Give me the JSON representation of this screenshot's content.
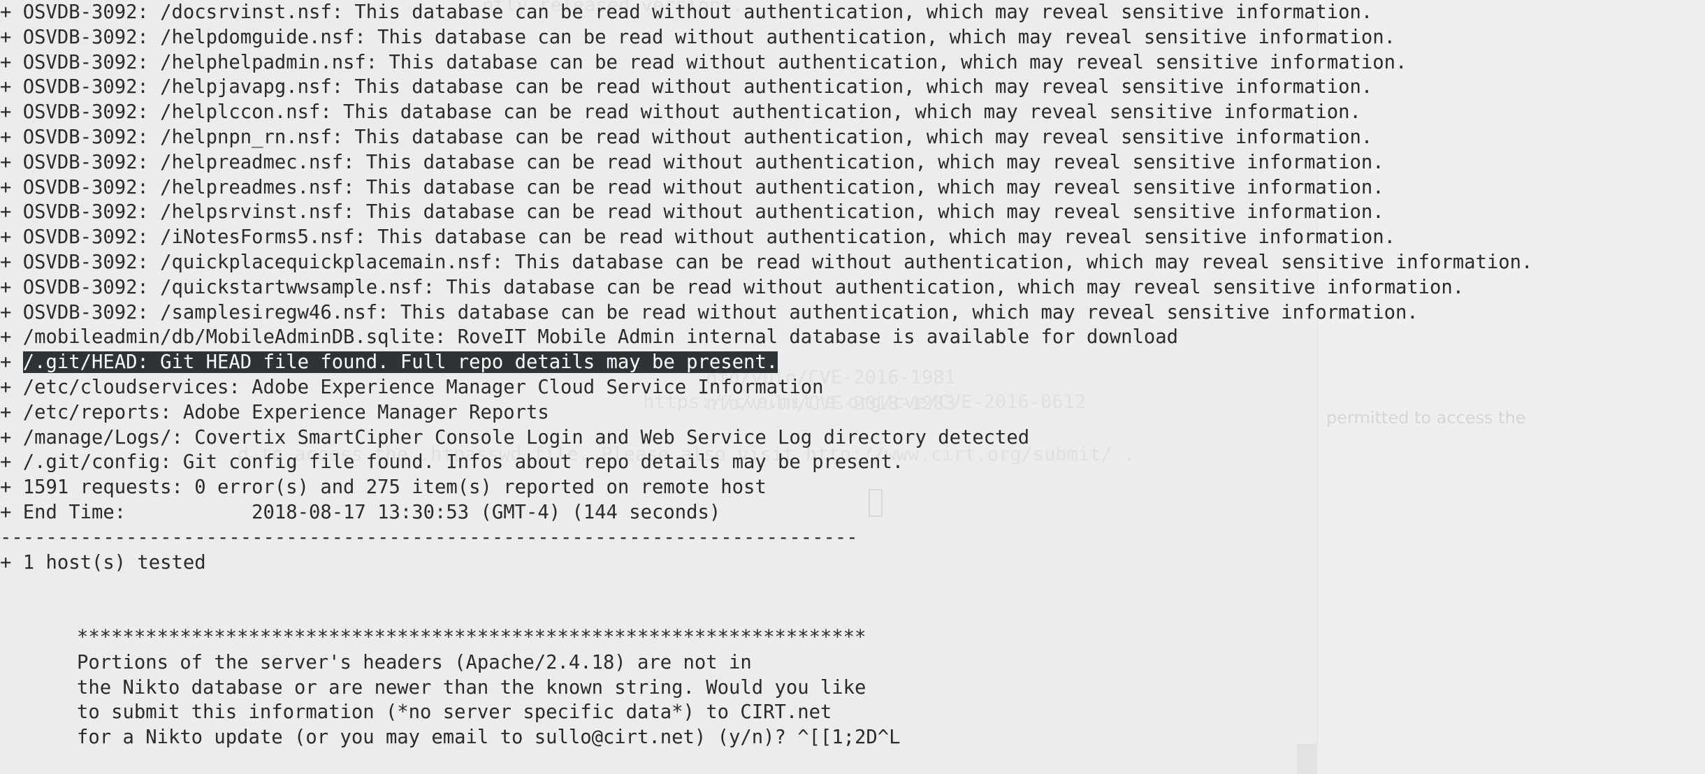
{
  "ghost": {
    "lines": [
      "ntly released versions.",
      "nfo/vuln/CVE-2016-1981",
      "nfo/vuln/CVE-2018-1283",
      "https://cve.mitre.org/cve/CVE-2016-0612",
      "d to access the .htpasswd file. Please also visit http://www.cirt.org/submit/ ."
    ],
    "side_text": "permitted to access the"
  },
  "terminal": {
    "osvdb_lines": [
      {
        "prefix": "+ ",
        "text": "OSVDB-3092: /docsrvinst.nsf: This database can be read without authentication, which may reveal sensitive information."
      },
      {
        "prefix": "+ ",
        "text": "OSVDB-3092: /helpdomguide.nsf: This database can be read without authentication, which may reveal sensitive information."
      },
      {
        "prefix": "+ ",
        "text": "OSVDB-3092: /helphelpadmin.nsf: This database can be read without authentication, which may reveal sensitive information."
      },
      {
        "prefix": "+ ",
        "text": "OSVDB-3092: /helpjavapg.nsf: This database can be read without authentication, which may reveal sensitive information."
      },
      {
        "prefix": "+ ",
        "text": "OSVDB-3092: /helplccon.nsf: This database can be read without authentication, which may reveal sensitive information."
      },
      {
        "prefix": "+ ",
        "text": "OSVDB-3092: /helpnpn_rn.nsf: This database can be read without authentication, which may reveal sensitive information."
      },
      {
        "prefix": "+ ",
        "text": "OSVDB-3092: /helpreadmec.nsf: This database can be read without authentication, which may reveal sensitive information."
      },
      {
        "prefix": "+ ",
        "text": "OSVDB-3092: /helpreadmes.nsf: This database can be read without authentication, which may reveal sensitive information."
      },
      {
        "prefix": "+ ",
        "text": "OSVDB-3092: /helpsrvinst.nsf: This database can be read without authentication, which may reveal sensitive information."
      },
      {
        "prefix": "+ ",
        "text": "OSVDB-3092: /iNotesForms5.nsf: This database can be read without authentication, which may reveal sensitive information."
      },
      {
        "prefix": "+ ",
        "text": "OSVDB-3092: /quickplacequickplacemain.nsf: This database can be read without authentication, which may reveal sensitive information."
      },
      {
        "prefix": "+ ",
        "text": "OSVDB-3092: /quickstartwwsample.nsf: This database can be read without authentication, which may reveal sensitive information."
      },
      {
        "prefix": "+ ",
        "text": "OSVDB-3092: /samplesiregw46.nsf: This database can be read without authentication, which may reveal sensitive information."
      }
    ],
    "mobileadmin": {
      "prefix": "+ ",
      "text": "/mobileadmin/db/MobileAdminDB.sqlite: RoveIT Mobile Admin internal database is available for download"
    },
    "git_head": {
      "prefix": "+ ",
      "text": "/.git/HEAD: Git HEAD file found. Full repo details may be present."
    },
    "after_lines": [
      {
        "prefix": "+ ",
        "text": "/etc/cloudservices: Adobe Experience Manager Cloud Service Information"
      },
      {
        "prefix": "+ ",
        "text": "/etc/reports: Adobe Experience Manager Reports"
      },
      {
        "prefix": "+ ",
        "text": "/manage/Logs/: Covertix SmartCipher Console Login and Web Service Log directory detected"
      },
      {
        "prefix": "+ ",
        "text": "/.git/config: Git config file found. Infos about repo details may be present."
      },
      {
        "prefix": "+ ",
        "text": "1591 requests: 0 error(s) and 275 item(s) reported on remote host"
      },
      {
        "prefix": "+ ",
        "text": "End Time:           2018-08-17 13:30:53 (GMT-4) (144 seconds)"
      }
    ],
    "separator": "---------------------------------------------------------------------------",
    "hosts_tested": "+ 1 host(s) tested",
    "stars": "*********************************************************************",
    "prompt_lines": [
      "Portions of the server's headers (Apache/2.4.18) are not in",
      "the Nikto database or are newer than the known string. Would you like",
      "to submit this information (*no server specific data*) to CIRT.net",
      "for a Nikto update (or you may email to sullo@cirt.net) (y/n)? ^[[1;2D^L"
    ]
  }
}
